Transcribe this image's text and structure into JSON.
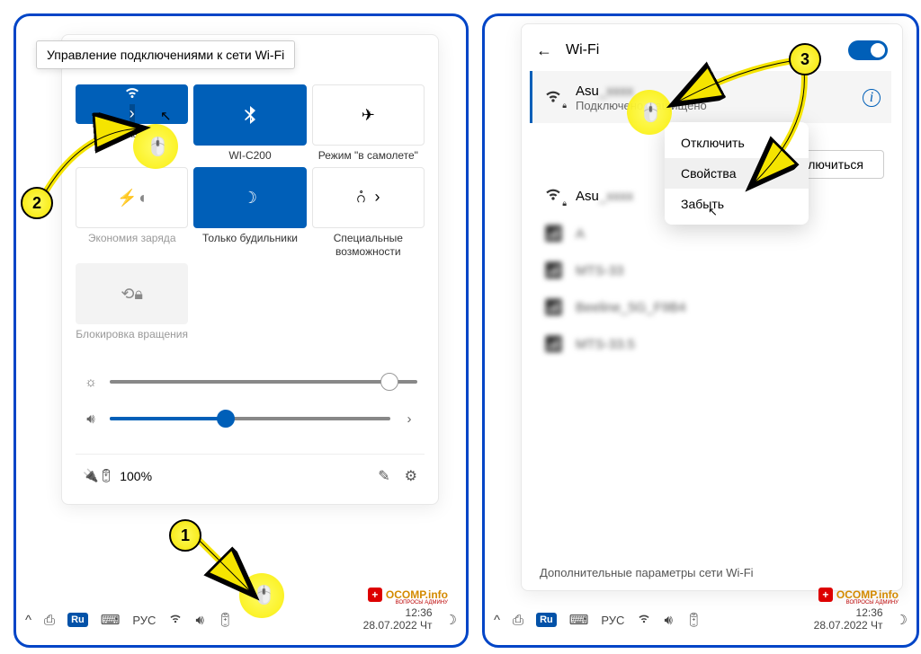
{
  "tooltip": "Управление подключениями к сети Wi-Fi",
  "tiles": {
    "wifi": "As",
    "bluetooth": "WI-C200",
    "airplane": "Режим \"в самолете\"",
    "battery": "Экономия заряда",
    "focus": "Только будильники",
    "access": "Специальные возможности",
    "lock": "Блокировка вращения"
  },
  "battery": "100%",
  "taskbar": {
    "lang": "РУС",
    "time": "12:36",
    "date": "28.07.2022 Чт"
  },
  "wifi": {
    "title": "Wi-Fi",
    "connected": {
      "name": "Asu",
      "status": "Подключено, защищено"
    },
    "disconnect_btn": "Отключиться",
    "more": "Дополнительные параметры сети Wi-Fi",
    "net2": "Asu",
    "net3": "A",
    "net4": "MTS-33",
    "net5": "Beeline_5G_F9B4",
    "net6": "MTS-33.5"
  },
  "menu": {
    "disconnect": "Отключить",
    "props": "Свойства",
    "forget": "Забыть"
  },
  "steps": {
    "s1": "1",
    "s2": "2",
    "s3": "3"
  },
  "logo": {
    "main": "OCOMP.info",
    "sub": "ВОПРОСЫ АДМИНУ"
  }
}
